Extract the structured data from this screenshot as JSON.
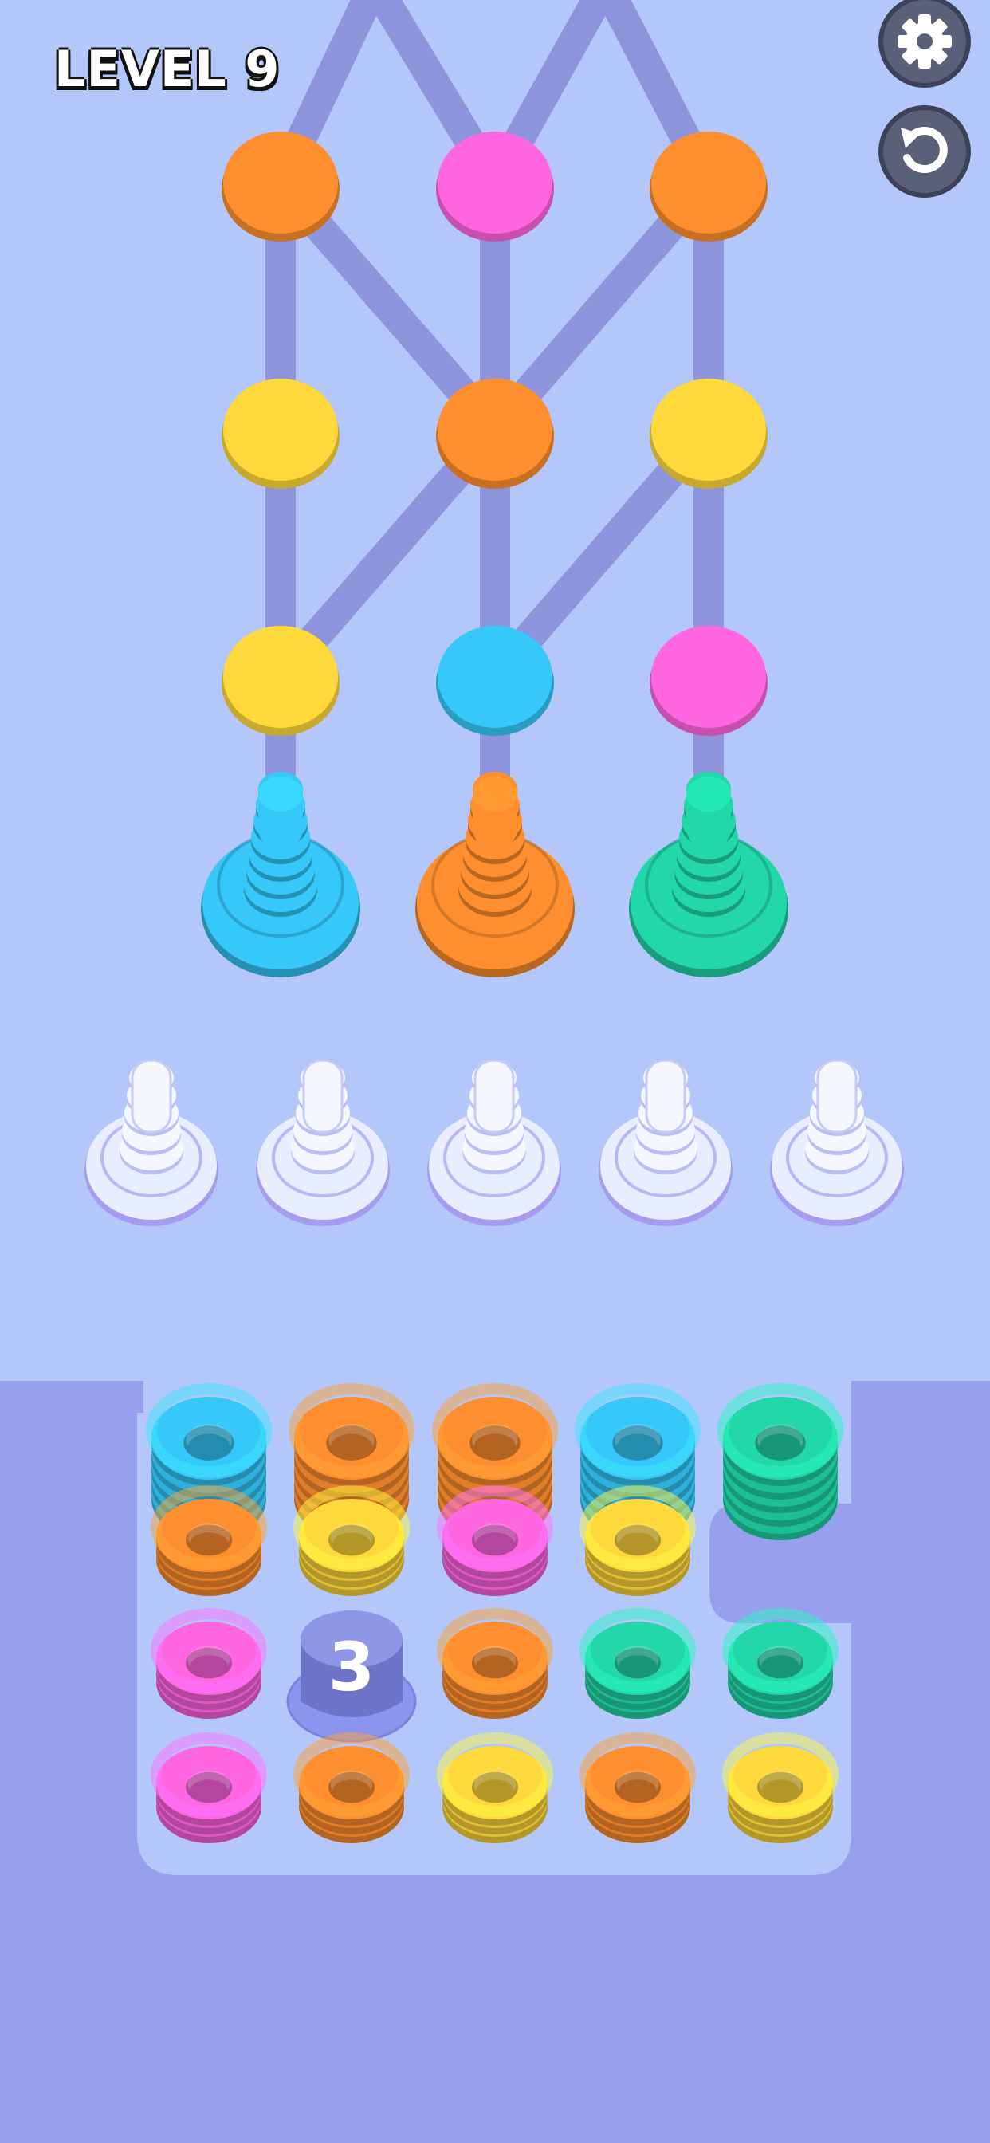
{
  "hud": {
    "level_label": "LEVEL 9",
    "settings_icon": "gear-icon",
    "restart_icon": "restart-icon"
  },
  "colors": {
    "orange": "#ff8f2e",
    "pink": "#ff66e0",
    "yellow": "#ffd93b",
    "cyan": "#35c8f8",
    "green": "#22d8a8",
    "background": "#b3c7fb",
    "tray": "#97a0ec"
  },
  "graph": {
    "nodes": [
      {
        "row": 0,
        "col": 0,
        "color": "orange"
      },
      {
        "row": 0,
        "col": 1,
        "color": "pink"
      },
      {
        "row": 0,
        "col": 2,
        "color": "orange"
      },
      {
        "row": 1,
        "col": 0,
        "color": "yellow"
      },
      {
        "row": 1,
        "col": 1,
        "color": "orange"
      },
      {
        "row": 1,
        "col": 2,
        "color": "yellow"
      },
      {
        "row": 2,
        "col": 0,
        "color": "yellow"
      },
      {
        "row": 2,
        "col": 1,
        "color": "cyan"
      },
      {
        "row": 2,
        "col": 2,
        "color": "pink"
      }
    ]
  },
  "target_pegs": [
    {
      "color": "cyan"
    },
    {
      "color": "orange"
    },
    {
      "color": "green"
    }
  ],
  "empty_pegs": {
    "count": 5
  },
  "tray": {
    "rows": [
      [
        {
          "color": "cyan",
          "stack": 5
        },
        {
          "color": "orange",
          "stack": 5
        },
        {
          "color": "orange",
          "stack": 5
        },
        {
          "color": "cyan",
          "stack": 5
        },
        {
          "color": "green",
          "stack": 5
        }
      ],
      [
        {
          "color": "orange",
          "stack": 3
        },
        {
          "color": "yellow",
          "stack": 3
        },
        {
          "color": "pink",
          "stack": 3
        },
        {
          "color": "yellow",
          "stack": 3
        }
      ],
      [
        {
          "color": "pink",
          "stack": 3
        },
        {
          "blocker": true,
          "label": "3"
        },
        {
          "color": "orange",
          "stack": 3
        },
        {
          "color": "green",
          "stack": 3
        },
        {
          "color": "green",
          "stack": 3
        }
      ],
      [
        {
          "color": "pink",
          "stack": 3
        },
        {
          "color": "orange",
          "stack": 3
        },
        {
          "color": "yellow",
          "stack": 3
        },
        {
          "color": "orange",
          "stack": 3
        },
        {
          "color": "yellow",
          "stack": 3
        }
      ]
    ]
  }
}
